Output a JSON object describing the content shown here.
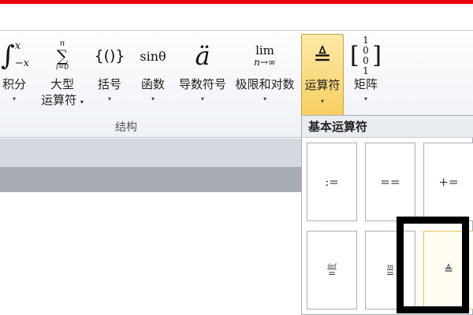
{
  "ribbon": {
    "buttons": [
      {
        "glyph": "∫₋ₓˣ",
        "label": "积分",
        "has_arrow": true
      },
      {
        "glyph": "∑",
        "label": "大型",
        "label2": "运算符",
        "has_arrow": true
      },
      {
        "glyph": "{()}",
        "label": "括号",
        "has_arrow": true
      },
      {
        "glyph": "sinθ",
        "label": "函数",
        "has_arrow": true
      },
      {
        "glyph": "ä",
        "label": "导数符号",
        "has_arrow": true
      },
      {
        "glyph_top": "lim",
        "glyph_bottom": "n→∞",
        "label": "极限和对数",
        "has_arrow": true
      },
      {
        "glyph": "≜",
        "label": "运算符",
        "has_arrow": true,
        "selected": true
      },
      {
        "glyph": "[10\n01]",
        "label": "矩阵",
        "has_arrow": true
      }
    ],
    "group_label": "结构",
    "sum_upper": "n",
    "sum_lower": "i=0",
    "integral_upper": "x",
    "integral_lower": "−x",
    "matrix_top": "1 0",
    "matrix_bottom": "0 1",
    "arrow_glyph": "▾"
  },
  "dropdown": {
    "title": "基本运算符",
    "row1": [
      ":=",
      "==",
      "+="
    ],
    "row2_cell1_top": "def",
    "row2_cell1_bottom": "=",
    "row2_cell2_top": "m",
    "row2_cell2_bottom": "=",
    "row2_cell3": "≜"
  },
  "colors": {
    "accent_red": "#e8000e",
    "selected_fill": "#f8cf62",
    "highlight_border": "#000000"
  }
}
